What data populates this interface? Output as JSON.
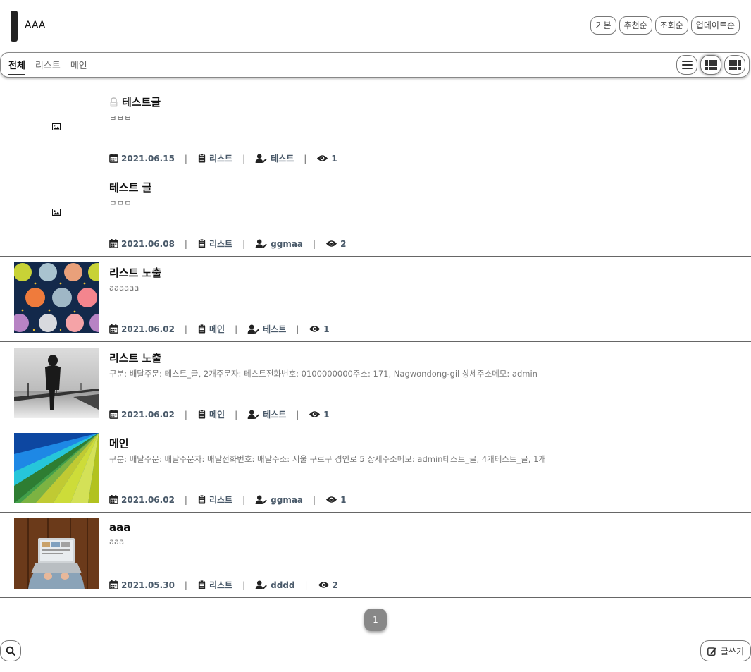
{
  "header": {
    "site_title": "AAA",
    "sort_options": [
      "기본",
      "추천순",
      "조회순",
      "업데이트순"
    ]
  },
  "nav": {
    "categories": [
      {
        "label": "전체",
        "active": true
      },
      {
        "label": "리스트",
        "active": false
      },
      {
        "label": "메인",
        "active": false
      }
    ],
    "view_modes": [
      {
        "icon": "list-icon",
        "active": false
      },
      {
        "icon": "detail-list-icon",
        "active": true
      },
      {
        "icon": "grid-icon",
        "active": false
      }
    ]
  },
  "posts": [
    {
      "title": "테스트글",
      "locked": true,
      "excerpt": "ㅂㅂㅂ",
      "thumb": "none",
      "date": "2021.06.15",
      "category": "리스트",
      "author": "테스트",
      "views": "1"
    },
    {
      "title": "테스트 글",
      "locked": false,
      "excerpt": "ㅁㅁㅁ",
      "thumb": "none",
      "date": "2021.06.08",
      "category": "리스트",
      "author": "ggmaa",
      "views": "2"
    },
    {
      "title": "리스트 노출",
      "locked": false,
      "excerpt": "aaaaaa",
      "thumb": "planets",
      "date": "2021.06.02",
      "category": "메인",
      "author": "테스트",
      "views": "1"
    },
    {
      "title": "리스트 노출",
      "locked": false,
      "excerpt": "구분: 배달주문: 테스트_글, 2개주문자: 테스트전화번호: 0100000000주소: 171, Nagwondong-gil 상세주소메모: admin",
      "thumb": "pier",
      "date": "2021.06.02",
      "category": "메인",
      "author": "테스트",
      "views": "1"
    },
    {
      "title": "메인",
      "locked": false,
      "excerpt": "구분: 배달주문: 배달주문자: 배달전화번호: 배달주소: 서울 구로구 경인로 5 상세주소메모: admin테스트_글, 4개테스트_글, 1개",
      "thumb": "rainbow",
      "date": "2021.06.02",
      "category": "리스트",
      "author": "ggmaa",
      "views": "1"
    },
    {
      "title": "aaa",
      "locked": false,
      "excerpt": "aaa",
      "thumb": "laptop",
      "date": "2021.05.30",
      "category": "리스트",
      "author": "dddd",
      "views": "2"
    }
  ],
  "pagination": {
    "current": "1"
  },
  "footer": {
    "write_label": "글쓰기"
  }
}
